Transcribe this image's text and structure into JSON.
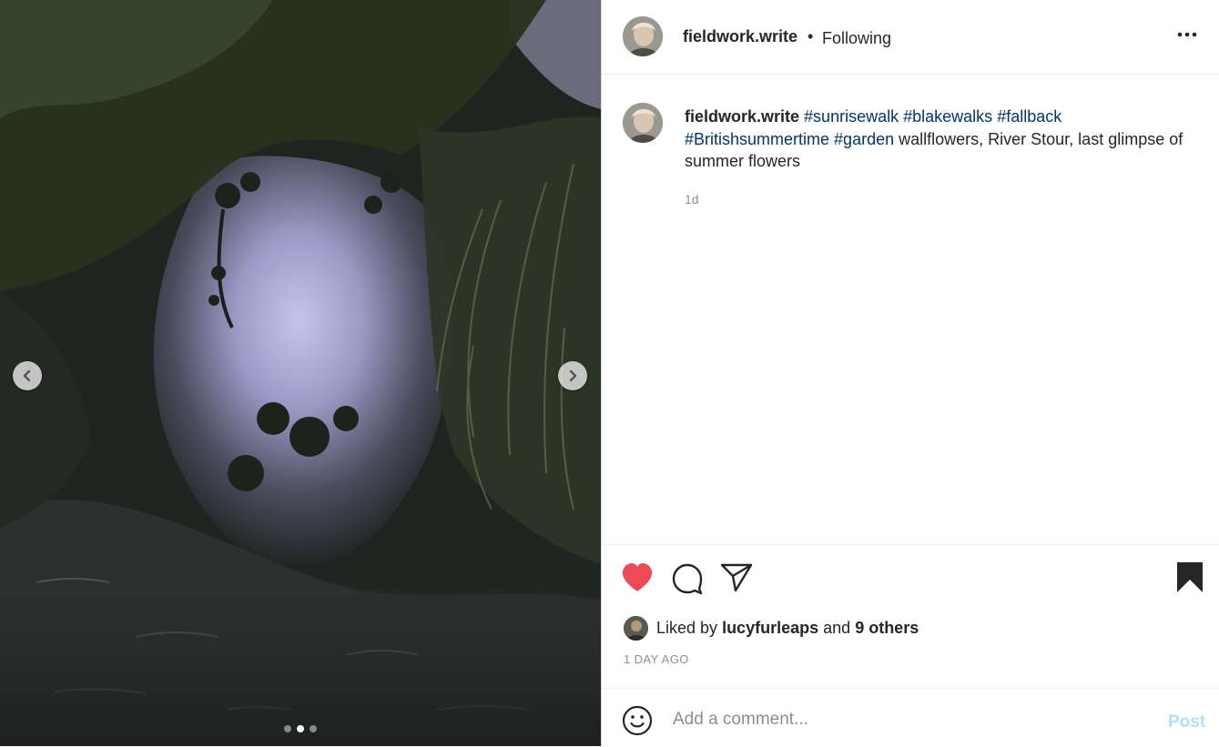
{
  "carousel": {
    "prev_icon": "chevron-left-icon",
    "next_icon": "chevron-right-icon",
    "slide_count": 3,
    "active_slide": 2
  },
  "header": {
    "username": "fieldwork.write",
    "bullet": "•",
    "follow_status": "Following",
    "more_icon": "more-options-icon"
  },
  "caption": {
    "username": "fieldwork.write",
    "hashtags_line1": [
      "#sunrisewalk",
      "#blakewalks",
      "#fallback"
    ],
    "hashtags_line2": [
      "#Britishsummertime",
      "#garden"
    ],
    "text": "wallflowers, River Stour, last glimpse of summer flowers",
    "time": "1d"
  },
  "actions": {
    "like_icon": "heart-filled-icon",
    "comment_icon": "comment-icon",
    "share_icon": "share-icon",
    "save_icon": "bookmark-filled-icon",
    "like_color": "#ed4956"
  },
  "likes": {
    "prefix": "Liked by",
    "user": "lucyfurleaps",
    "and": "and",
    "others": "9 others"
  },
  "timestamp": "1 DAY AGO",
  "comment": {
    "placeholder": "Add a comment...",
    "post_label": "Post",
    "emoji_icon": "emoji-icon"
  }
}
